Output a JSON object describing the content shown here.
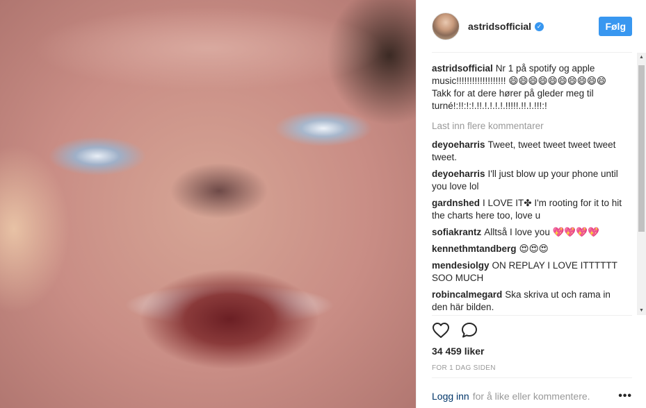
{
  "post": {
    "username": "astridsofficial",
    "follow_label": "Følg",
    "caption": {
      "user": "astridsofficial",
      "text": "Nr 1 på spotify og apple music!!!!!!!!!!!!!!!!!!! 😄😄😄😄😄😄😄😄😄😄 Takk for at dere hører på gleder meg til turné!:!!:!:!.!!.!.!.!.!.!!!!!.!!.!.!!!:!"
    },
    "load_more": "Last inn flere kommentarer",
    "comments": [
      {
        "user": "deyoeharris",
        "text": "Tweet, tweet tweet tweet tweet tweet."
      },
      {
        "user": "deyoeharris",
        "text": "I'll just blow up your phone until you love lol"
      },
      {
        "user": "gardnshed",
        "text": "I LOVE IT✤ I'm rooting for it to hit the charts here too, love u"
      },
      {
        "user": "sofiakrantz",
        "text": "Alltså I love you 💖💖💖💖"
      },
      {
        "user": "kennethmtandberg",
        "text": "😍😍😍"
      },
      {
        "user": "mendesiolgy",
        "text": "ON REPLAY I LOVE ITTTTTT SOO MUCH"
      },
      {
        "user": "robincalmegard",
        "text": "Ska skriva ut och rama in den här bilden."
      }
    ],
    "likes": "34 459 liker",
    "timestamp": "FOR 1 DAG SIDEN",
    "footer": {
      "login_label": "Logg inn",
      "text": "for å like eller kommentere.",
      "more": "•••"
    },
    "icons": {
      "like": "heart-icon",
      "comment": "comment-icon",
      "verified": "verified-badge-icon",
      "more": "more-options-icon"
    },
    "colors": {
      "accent": "#3897f0",
      "link": "#003569",
      "muted": "#999999"
    }
  }
}
